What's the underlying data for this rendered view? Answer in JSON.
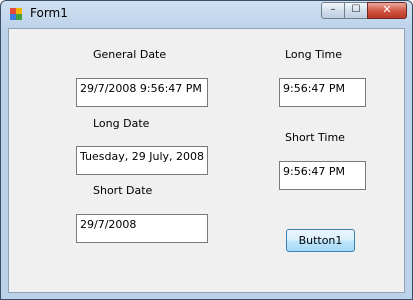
{
  "window": {
    "title": "Form1",
    "controls": {
      "minimize": "–",
      "maximize": "☐",
      "close": "✕"
    }
  },
  "labels": {
    "general_date": "General Date",
    "long_date": "Long Date",
    "short_date": "Short Date",
    "long_time": "Long Time",
    "short_time": "Short Time"
  },
  "fields": {
    "general_date_value": "29/7/2008 9:56:47 PM",
    "long_date_value": "Tuesday, 29 July, 2008",
    "short_date_value": "29/7/2008",
    "long_time_value": "9:56:47 PM",
    "short_time_value": "9:56:47 PM"
  },
  "button": {
    "label": "Button1"
  }
}
